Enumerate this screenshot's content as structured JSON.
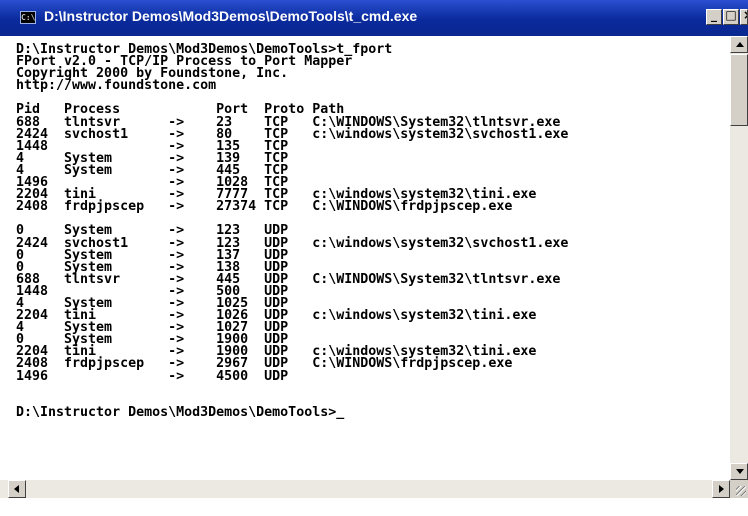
{
  "window": {
    "title": "D:\\Instructor Demos\\Mod3Demos\\DemoTools\\t_cmd.exe",
    "icon_label": "C:\\",
    "icon": "console-icon",
    "controls": {
      "minimize_glyph": "_",
      "maximize_glyph": "□",
      "close_glyph": "×"
    }
  },
  "colors": {
    "titlebar": "#0a2a9c",
    "console_bg": "#ffffff",
    "console_text": "#000000"
  },
  "console": {
    "text": "D:\\Instructor Demos\\Mod3Demos\\DemoTools>t_fport\nFPort v2.0 - TCP/IP Process to Port Mapper\nCopyright 2000 by Foundstone, Inc.\nhttp://www.foundstone.com\n\nPid   Process            Port  Proto Path\n688   tlntsvr      ->    23    TCP   C:\\WINDOWS\\System32\\tlntsvr.exe\n2424  svchost1     ->    80    TCP   c:\\windows\\system32\\svchost1.exe\n1448               ->    135   TCP\n4     System       ->    139   TCP\n4     System       ->    445   TCP\n1496               ->    1028  TCP\n2204  tini         ->    7777  TCP   c:\\windows\\system32\\tini.exe\n2408  frdpjpscep   ->    27374 TCP   C:\\WINDOWS\\frdpjpscep.exe\n\n0     System       ->    123   UDP\n2424  svchost1     ->    123   UDP   c:\\windows\\system32\\svchost1.exe\n0     System       ->    137   UDP\n0     System       ->    138   UDP\n688   tlntsvr      ->    445   UDP   C:\\WINDOWS\\System32\\tlntsvr.exe\n1448               ->    500   UDP\n4     System       ->    1025  UDP\n2204  tini         ->    1026  UDP   c:\\windows\\system32\\tini.exe\n4     System       ->    1027  UDP\n0     System       ->    1900  UDP\n2204  tini         ->    1900  UDP   c:\\windows\\system32\\tini.exe\n2408  frdpjpscep   ->    2967  UDP   C:\\WINDOWS\\frdpjpscep.exe\n1496               ->    4500  UDP\n\n\nD:\\Instructor Demos\\Mod3Demos\\DemoTools>_"
  }
}
